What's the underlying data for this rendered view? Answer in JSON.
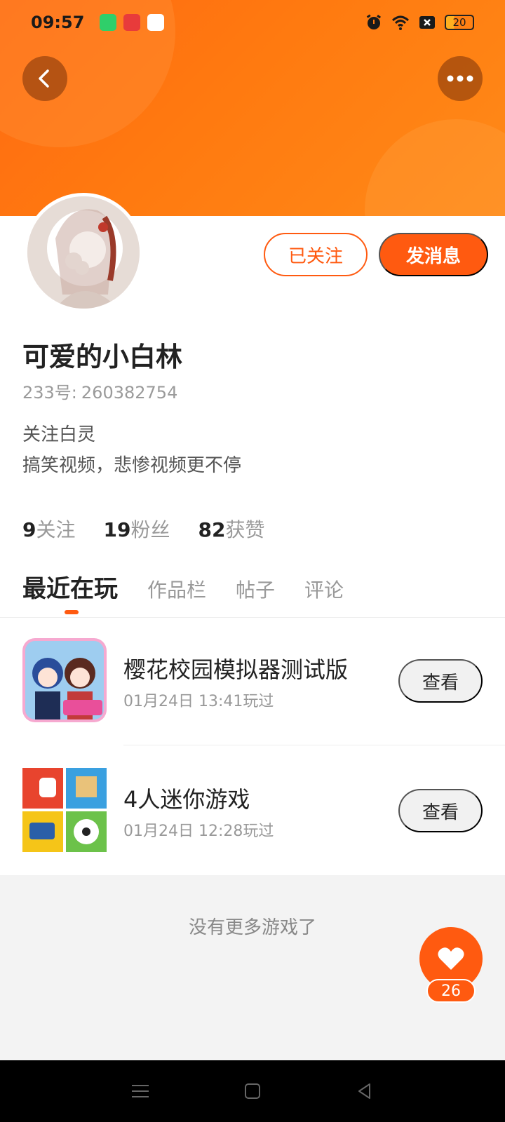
{
  "status_bar": {
    "time": "09:57",
    "battery": "20",
    "icons": [
      "alarm-icon",
      "wifi-icon",
      "sim-off-icon",
      "battery-icon"
    ]
  },
  "header": {
    "back_icon": "chevron-left-icon",
    "more_icon": "more-dots-icon",
    "accent_color": "#ff6a12"
  },
  "profile": {
    "followed_label": "已关注",
    "message_label": "发消息",
    "name": "可爱的小白林",
    "id_label": "233号:",
    "id_value": "260382754",
    "bio_line1": "关注白灵",
    "bio_line2": "搞笑视频，悲惨视频更不停",
    "stats": [
      {
        "value": "9",
        "label": "关注"
      },
      {
        "value": "19",
        "label": "粉丝"
      },
      {
        "value": "82",
        "label": "获赞"
      }
    ]
  },
  "tabs": [
    "最近在玩",
    "作品栏",
    "帖子",
    "评论"
  ],
  "games": [
    {
      "title": "樱花校园模拟器测试版",
      "time": "01月24日 13:41玩过",
      "button": "查看"
    },
    {
      "title": "4人迷你游戏",
      "time": "01月24日 12:28玩过",
      "button": "查看"
    }
  ],
  "footer_text": "没有更多游戏了",
  "like": {
    "icon": "heart-icon",
    "count": "26"
  },
  "nav": [
    "menu-icon",
    "home-square-icon",
    "back-triangle-icon"
  ]
}
